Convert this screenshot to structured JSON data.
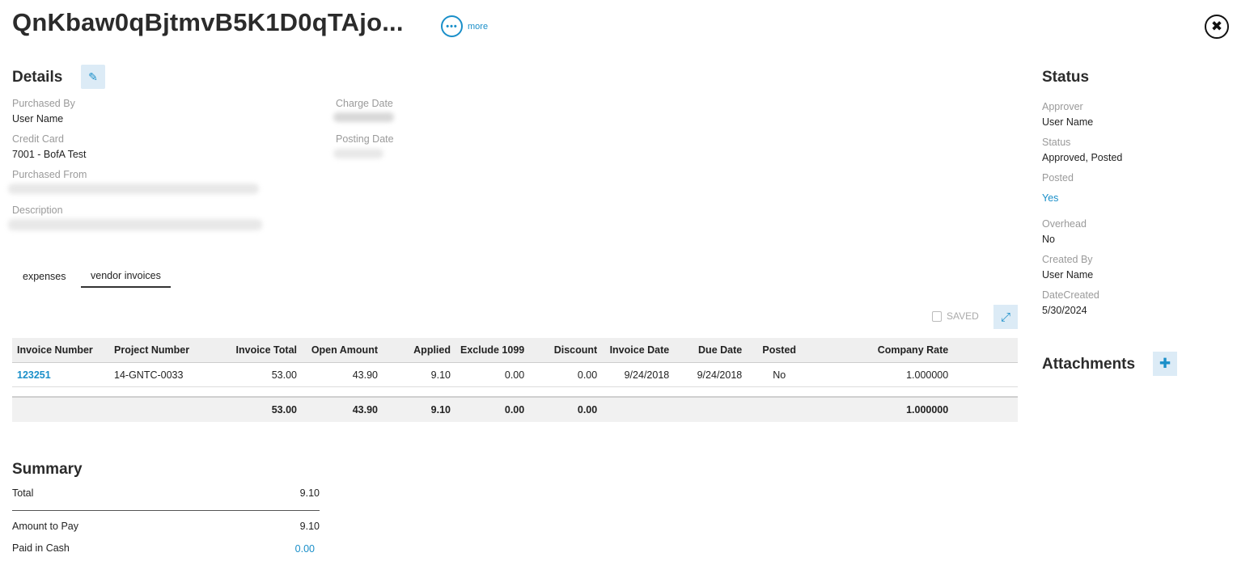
{
  "header": {
    "title": "QnKbaw0qBjtmvB5K1D0qTAjo...",
    "more_label": "more",
    "more_glyph": "•••",
    "close_glyph": "✖"
  },
  "details": {
    "heading": "Details",
    "edit_glyph": "✎",
    "purchased_by": {
      "label": "Purchased By",
      "value": "User Name"
    },
    "credit_card": {
      "label": "Credit Card",
      "value": "7001 - BofA Test"
    },
    "purchased_from": {
      "label": "Purchased From"
    },
    "description": {
      "label": "Description"
    },
    "charge_date": {
      "label": "Charge Date"
    },
    "posting_date": {
      "label": "Posting Date"
    }
  },
  "tabs": [
    {
      "label": "expenses",
      "active": false
    },
    {
      "label": "vendor invoices",
      "active": true
    }
  ],
  "toolbar": {
    "saved_label": "SAVED",
    "expand_glyph": "⤢"
  },
  "table": {
    "columns": [
      "Invoice Number",
      "Project Number",
      "Invoice Total",
      "Open Amount",
      "Applied",
      "Exclude 1099",
      "Discount",
      "Invoice Date",
      "Due Date",
      "Posted",
      "Company Rate"
    ],
    "rows": [
      {
        "invoice_number": "123251",
        "project_number": "14-GNTC-0033",
        "invoice_total": "53.00",
        "open_amount": "43.90",
        "applied": "9.10",
        "exclude_1099": "0.00",
        "discount": "0.00",
        "invoice_date": "9/24/2018",
        "due_date": "9/24/2018",
        "posted": "No",
        "company_rate": "1.000000"
      }
    ],
    "totals": {
      "invoice_total": "53.00",
      "open_amount": "43.90",
      "applied": "9.10",
      "exclude_1099": "0.00",
      "discount": "0.00",
      "company_rate": "1.000000"
    }
  },
  "summary": {
    "heading": "Summary",
    "total": {
      "label": "Total",
      "value": "9.10"
    },
    "amount_to_pay": {
      "label": "Amount to Pay",
      "value": "9.10"
    },
    "paid_in_cash": {
      "label": "Paid in Cash",
      "value": "0.00"
    }
  },
  "status": {
    "heading": "Status",
    "approver": {
      "label": "Approver",
      "value": "User Name"
    },
    "status": {
      "label": "Status",
      "value": "Approved, Posted"
    },
    "posted": {
      "label": "Posted",
      "value": "Yes"
    },
    "overhead": {
      "label": "Overhead",
      "value": "No"
    },
    "created_by": {
      "label": "Created By",
      "value": "User Name"
    },
    "date_created": {
      "label": "DateCreated",
      "value": "5/30/2024"
    }
  },
  "attachments": {
    "heading": "Attachments",
    "add_glyph": "✚"
  },
  "colors": {
    "accent": "#1a8fc9",
    "button_bg": "#dcebf6",
    "label": "#9a9a9a"
  }
}
